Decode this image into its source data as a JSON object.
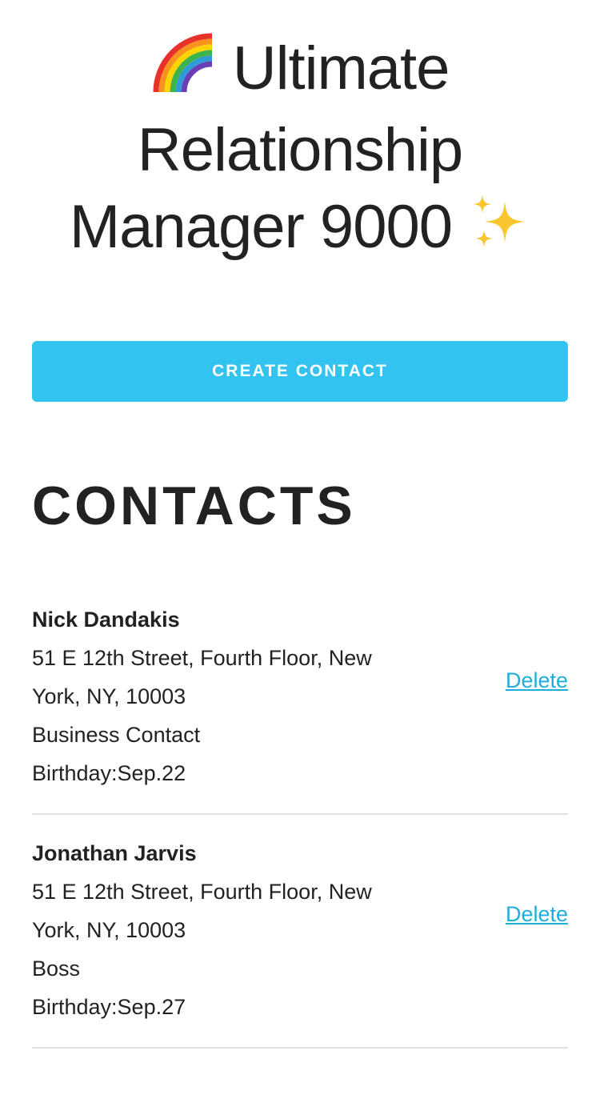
{
  "header": {
    "title_lines": [
      "Ultimate",
      "Relationship",
      "Manager 9000"
    ],
    "leading_icon": "rainbow-icon",
    "trailing_icon": "sparkles-icon"
  },
  "actions": {
    "create_label": "CREATE CONTACT"
  },
  "contacts_section": {
    "heading": "CONTACTS",
    "items": [
      {
        "name": "Nick Dandakis",
        "address": "51 E 12th Street, Fourth Floor, New York, NY, 10003",
        "relationship": "Business Contact",
        "birthday": "Birthday:Sep.22",
        "delete_label": "Delete"
      },
      {
        "name": "Jonathan Jarvis",
        "address": "51 E 12th Street, Fourth Floor, New York, NY, 10003",
        "relationship": "Boss",
        "birthday": "Birthday:Sep.27",
        "delete_label": "Delete"
      }
    ]
  },
  "colors": {
    "accent": "#33c3f0",
    "link": "#1eaedb",
    "text": "#222222",
    "divider": "#e1e1e1"
  }
}
